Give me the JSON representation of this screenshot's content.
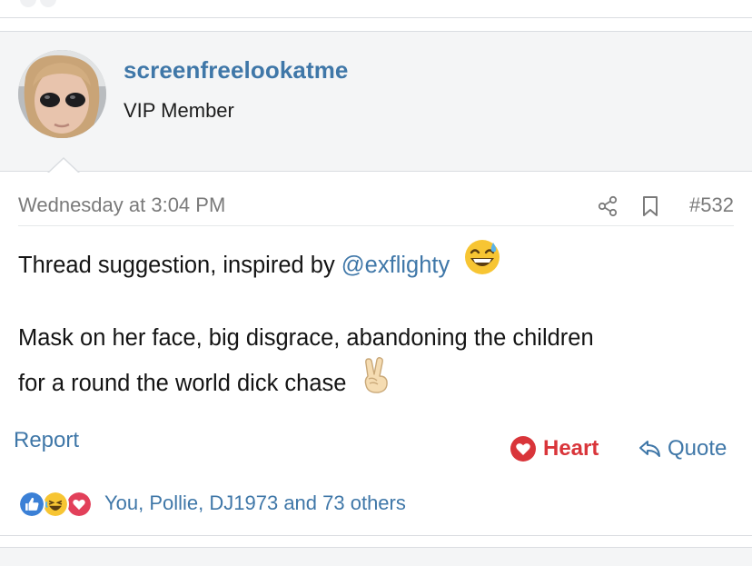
{
  "post": {
    "username": "screenfreelookatme",
    "user_title": "VIP Member",
    "date": "Wednesday at 3:04 PM",
    "number": "#532",
    "body": {
      "line1_text": "Thread suggestion, inspired by ",
      "mention": "@exflighty",
      "line2": "Mask on her face, big disgrace, abandoning the children",
      "line3": "for a round the world dick chase"
    },
    "actions": {
      "report": "Report",
      "heart": "Heart",
      "quote": "Quote"
    },
    "reactions": {
      "summary": "You, Pollie, DJ1973 and 73 others"
    }
  },
  "icons": {
    "share": "share-icon",
    "bookmark": "bookmark-icon",
    "heart": "heart-icon",
    "quote": "reply-arrow-icon",
    "reaction_like": "thumbs-up-icon",
    "reaction_laugh": "laughing-emoji-icon",
    "reaction_love": "heart-reaction-icon",
    "emoji_sweat": "grinning-sweat-emoji",
    "emoji_peace": "victory-hand-emoji"
  },
  "colors": {
    "link": "#3f77a8",
    "heart": "#d9353a",
    "meta_text": "#7a7a7a",
    "user_block_bg": "#f4f5f6",
    "border": "#dadde1"
  }
}
